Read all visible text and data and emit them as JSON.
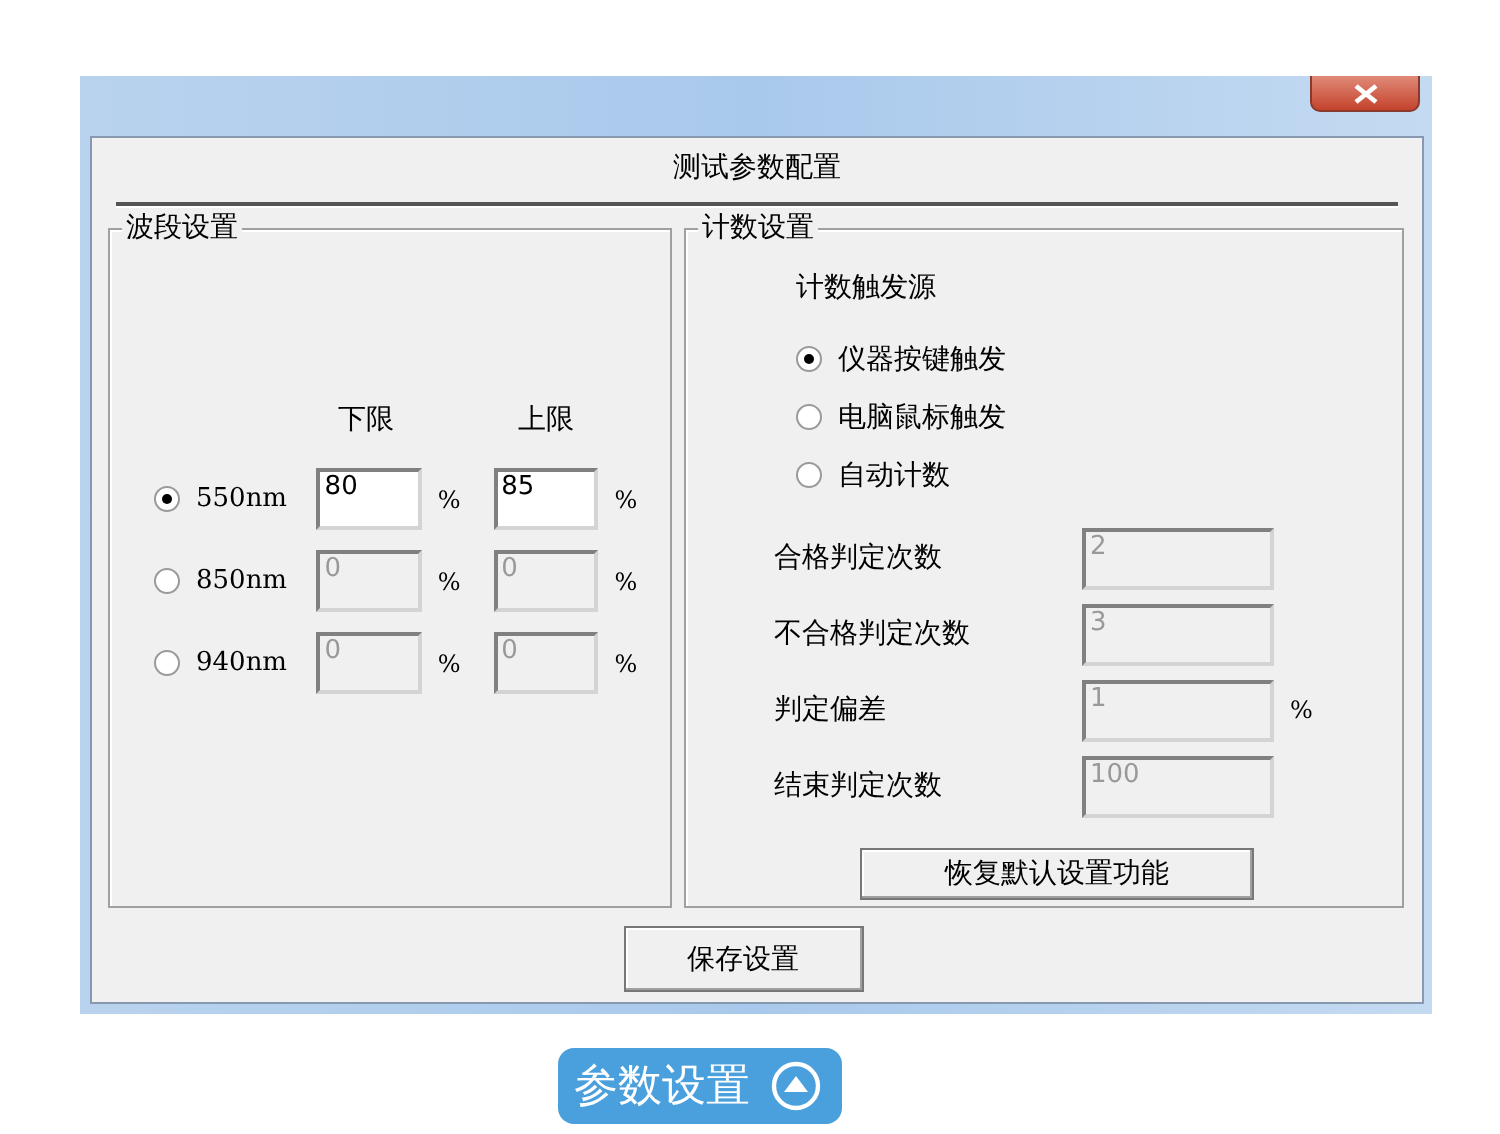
{
  "dialog": {
    "title": "测试参数配置"
  },
  "band_group": {
    "title": "波段设置",
    "column_headers": [
      "下限",
      "上限"
    ],
    "rows": [
      {
        "label": "550nm",
        "selected": true,
        "disabled": false,
        "lower": "80",
        "lower_unit": "%",
        "upper": "85",
        "upper_unit": "%"
      },
      {
        "label": "850nm",
        "selected": false,
        "disabled": true,
        "lower": "0",
        "lower_unit": "%",
        "upper": "0",
        "upper_unit": "%"
      },
      {
        "label": "940nm",
        "selected": false,
        "disabled": true,
        "lower": "0",
        "lower_unit": "%",
        "upper": "0",
        "upper_unit": "%"
      }
    ]
  },
  "count_group": {
    "title": "计数设置",
    "trigger_heading": "计数触发源",
    "triggers": [
      {
        "label": "仪器按键触发",
        "selected": true
      },
      {
        "label": "电脑鼠标触发",
        "selected": false
      },
      {
        "label": "自动计数",
        "selected": false
      }
    ],
    "fields": [
      {
        "label": "合格判定次数",
        "value": "2",
        "disabled": true
      },
      {
        "label": "不合格判定次数",
        "value": "3",
        "disabled": true
      },
      {
        "label": "判定偏差",
        "value": "1",
        "disabled": true,
        "unit": "%"
      },
      {
        "label": "结束判定次数",
        "value": "100",
        "disabled": true
      }
    ],
    "reset_button": "恢复默认设置功能"
  },
  "save_button": "保存设置",
  "footer_badge": "参数设置"
}
